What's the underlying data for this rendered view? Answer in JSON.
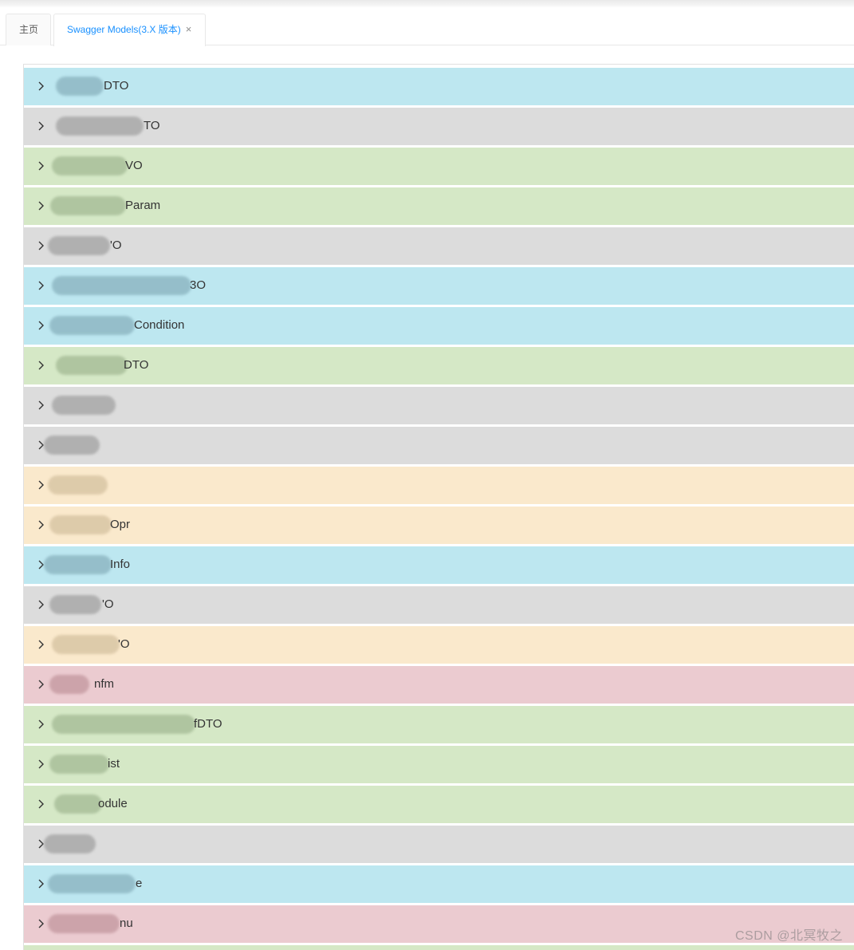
{
  "tabs": {
    "home_label": "主页",
    "models_label": "Swagger Models(3.X 版本)",
    "close_glyph": "×"
  },
  "models": [
    {
      "suffix": "DTO",
      "color": "#bde7f0"
    },
    {
      "suffix": "TO",
      "color": "#dcdcdc"
    },
    {
      "suffix": "VO",
      "color": "#d5e8c6"
    },
    {
      "suffix": "Param",
      "color": "#d5e8c6"
    },
    {
      "suffix": "'O",
      "color": "#dcdcdc"
    },
    {
      "suffix": "3O",
      "color": "#bde7f0"
    },
    {
      "suffix": "Condition",
      "color": "#bde7f0"
    },
    {
      "suffix": "DTO",
      "color": "#d5e8c6"
    },
    {
      "suffix": "",
      "color": "#dcdcdc"
    },
    {
      "suffix": "",
      "color": "#dcdcdc"
    },
    {
      "suffix": "",
      "color": "#fae9cc"
    },
    {
      "suffix": "Opr",
      "color": "#fae9cc"
    },
    {
      "suffix": "Info",
      "color": "#bde7f0"
    },
    {
      "suffix": "'O",
      "color": "#dcdcdc"
    },
    {
      "suffix": "'O",
      "color": "#fae9cc"
    },
    {
      "suffix": "nfm",
      "color": "#ebcbd0"
    },
    {
      "suffix": "fDTO",
      "color": "#d5e8c6"
    },
    {
      "suffix": "ist",
      "color": "#d5e8c6"
    },
    {
      "suffix": "odule",
      "color": "#d5e8c6"
    },
    {
      "suffix": "",
      "color": "#dcdcdc"
    },
    {
      "suffix": "e",
      "color": "#bde7f0"
    },
    {
      "suffix": "nu",
      "color": "#ebcbd0"
    },
    {
      "suffix": "",
      "color": "#d5e8c6"
    }
  ],
  "watermark": "CSDN @北冥牧之"
}
